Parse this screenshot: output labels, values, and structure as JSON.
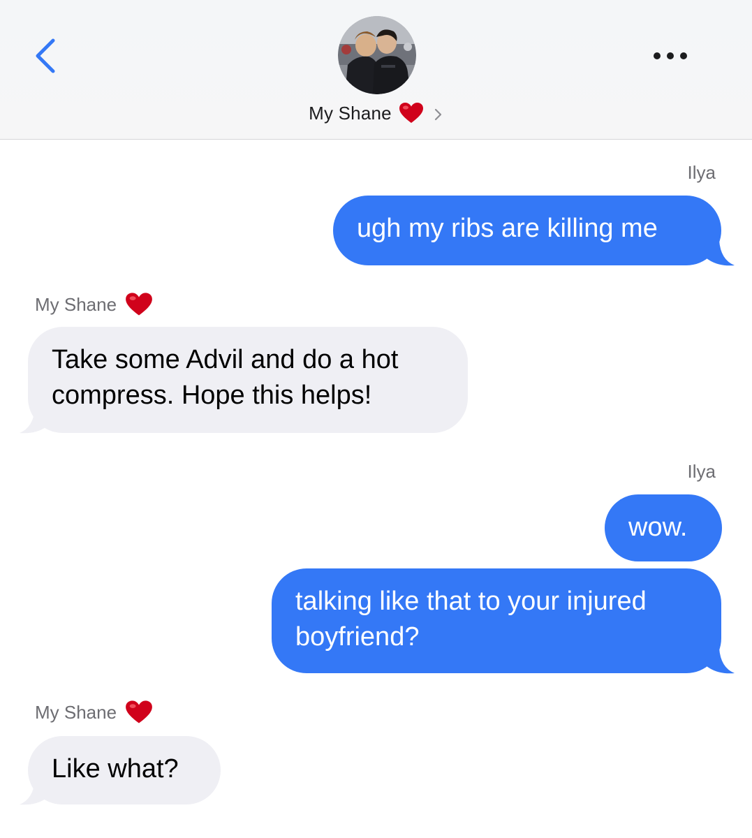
{
  "header": {
    "contact_name": "My Shane",
    "contact_emoji": "heart-emoji"
  },
  "messages": [
    {
      "sender": "Ilya",
      "direction": "outgoing",
      "text": "ugh my ribs are killing me"
    },
    {
      "sender": "My Shane",
      "direction": "incoming",
      "text": "Take some Advil and do a hot compress. Hope this helps!"
    },
    {
      "sender": "Ilya",
      "direction": "outgoing",
      "text": "wow."
    },
    {
      "sender": "Ilya",
      "direction": "outgoing",
      "text": "talking like that to your injured boyfriend?"
    },
    {
      "sender": "My Shane",
      "direction": "incoming",
      "text": "Like what?"
    }
  ],
  "colors": {
    "outgoing_bubble": "#3478f6",
    "incoming_bubble": "#efeff4",
    "accent": "#3478f6",
    "heart": "#d0021b"
  }
}
